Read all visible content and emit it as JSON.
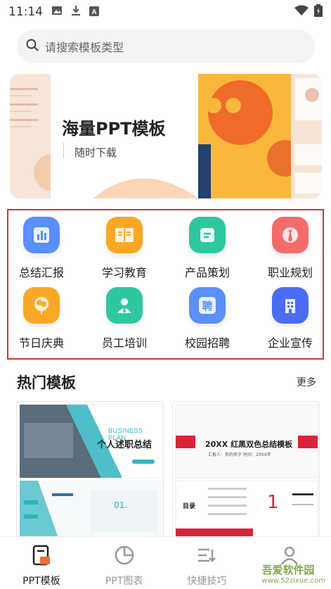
{
  "status_bar": {
    "time": "11:14",
    "left_icons": [
      "image-icon",
      "download-icon",
      "a-text-icon"
    ],
    "right_icons": [
      "wifi-icon",
      "battery-icon"
    ]
  },
  "search": {
    "placeholder": "请搜索模板类型"
  },
  "banner": {
    "title": "海量PPT模板",
    "subtitle": "随时下载"
  },
  "categories": [
    {
      "label": "总结汇报",
      "icon": "chart-icon",
      "color": "#5b8ff9"
    },
    {
      "label": "学习教育",
      "icon": "book-icon",
      "color": "#f9a825"
    },
    {
      "label": "产品策划",
      "icon": "document-icon",
      "color": "#2fc7a0"
    },
    {
      "label": "职业规划",
      "icon": "tie-icon",
      "color": "#f46b6b"
    },
    {
      "label": "节日庆典",
      "icon": "balloon-icon",
      "color": "#f9a825"
    },
    {
      "label": "员工培训",
      "icon": "person-icon",
      "color": "#2fc7a0"
    },
    {
      "label": "校园招聘",
      "icon": "hire-icon",
      "color": "#5b8ff9"
    },
    {
      "label": "企业宣传",
      "icon": "building-icon",
      "color": "#4b6cf5"
    }
  ],
  "hot": {
    "title": "热门模板",
    "more": "更多"
  },
  "templates": [
    {
      "tag": "BUSINESS PLAN",
      "title": "个人述职总结",
      "button": "",
      "bottom_label": "01."
    },
    {
      "title": "20XX 红黑双色总结模板",
      "subtitle": "汇报人：你的名字   时间：20XX年",
      "toc_label": "目录",
      "big_number": "1"
    }
  ],
  "tabbar": {
    "items": [
      {
        "label": "PPT模板",
        "icon": "document-icon",
        "active": true
      },
      {
        "label": "PPT图表",
        "icon": "pie-chart-icon",
        "active": false
      },
      {
        "label": "快捷技巧",
        "icon": "list-icon",
        "active": false
      },
      {
        "label": "",
        "icon": "user-icon",
        "active": false
      }
    ]
  },
  "watermark": {
    "text": "吾爱软件园",
    "url": "www.52zixue.com"
  },
  "colors": {
    "accent": "#f46b2a",
    "highlight_border": "#d83333",
    "tab_active": "#222222",
    "tab_inactive": "#999999"
  }
}
